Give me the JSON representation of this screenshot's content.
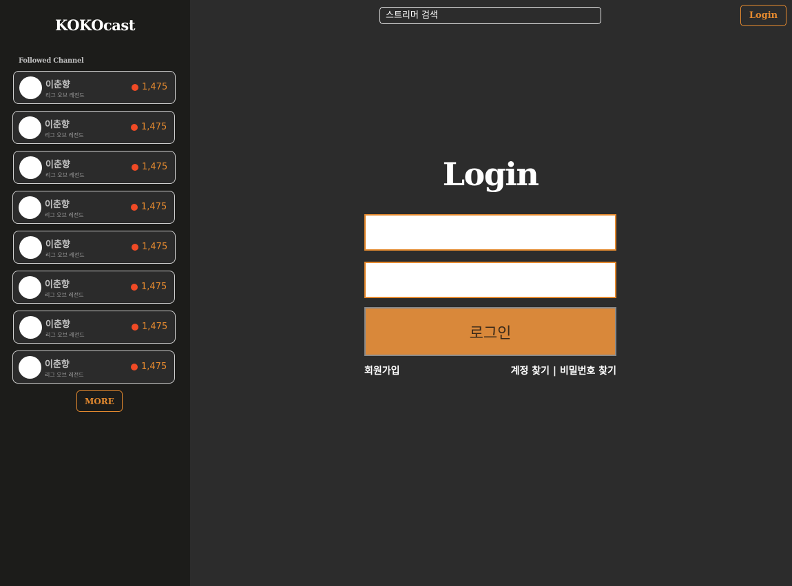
{
  "sidebar": {
    "brand": "KOKOcast",
    "followed_title": "Followed Channel",
    "channels": [
      {
        "name": "이춘향",
        "game": "리그 오브 레전드",
        "viewers": "1,475"
      },
      {
        "name": "이춘향",
        "game": "리그 오브 레전드",
        "viewers": "1,475"
      },
      {
        "name": "이춘향",
        "game": "리그 오브 레전드",
        "viewers": "1,475"
      },
      {
        "name": "이춘향",
        "game": "리그 오브 레전드",
        "viewers": "1,475"
      },
      {
        "name": "이춘향",
        "game": "리그 오브 레전드",
        "viewers": "1,475"
      },
      {
        "name": "이춘향",
        "game": "리그 오브 레전드",
        "viewers": "1,475"
      },
      {
        "name": "이춘향",
        "game": "리그 오브 레전드",
        "viewers": "1,475"
      },
      {
        "name": "이춘향",
        "game": "리그 오브 레전드",
        "viewers": "1,475"
      }
    ],
    "more_label": "MORE"
  },
  "header": {
    "search_placeholder": "스트리머 검색",
    "login_label": "Login"
  },
  "login_form": {
    "title": "Login",
    "id_value": "",
    "password_value": "",
    "submit_label": "로그인",
    "signup_label": "회원가입",
    "find_account_label": "계정 찾기",
    "separator": "|",
    "find_password_label": "비밀번호 찾기"
  },
  "colors": {
    "accent": "#e58a2f",
    "live": "#f04a25",
    "sidebar_bg": "#1c1c1a",
    "main_bg": "#2c2c2c",
    "button_fill": "#d9883a"
  }
}
